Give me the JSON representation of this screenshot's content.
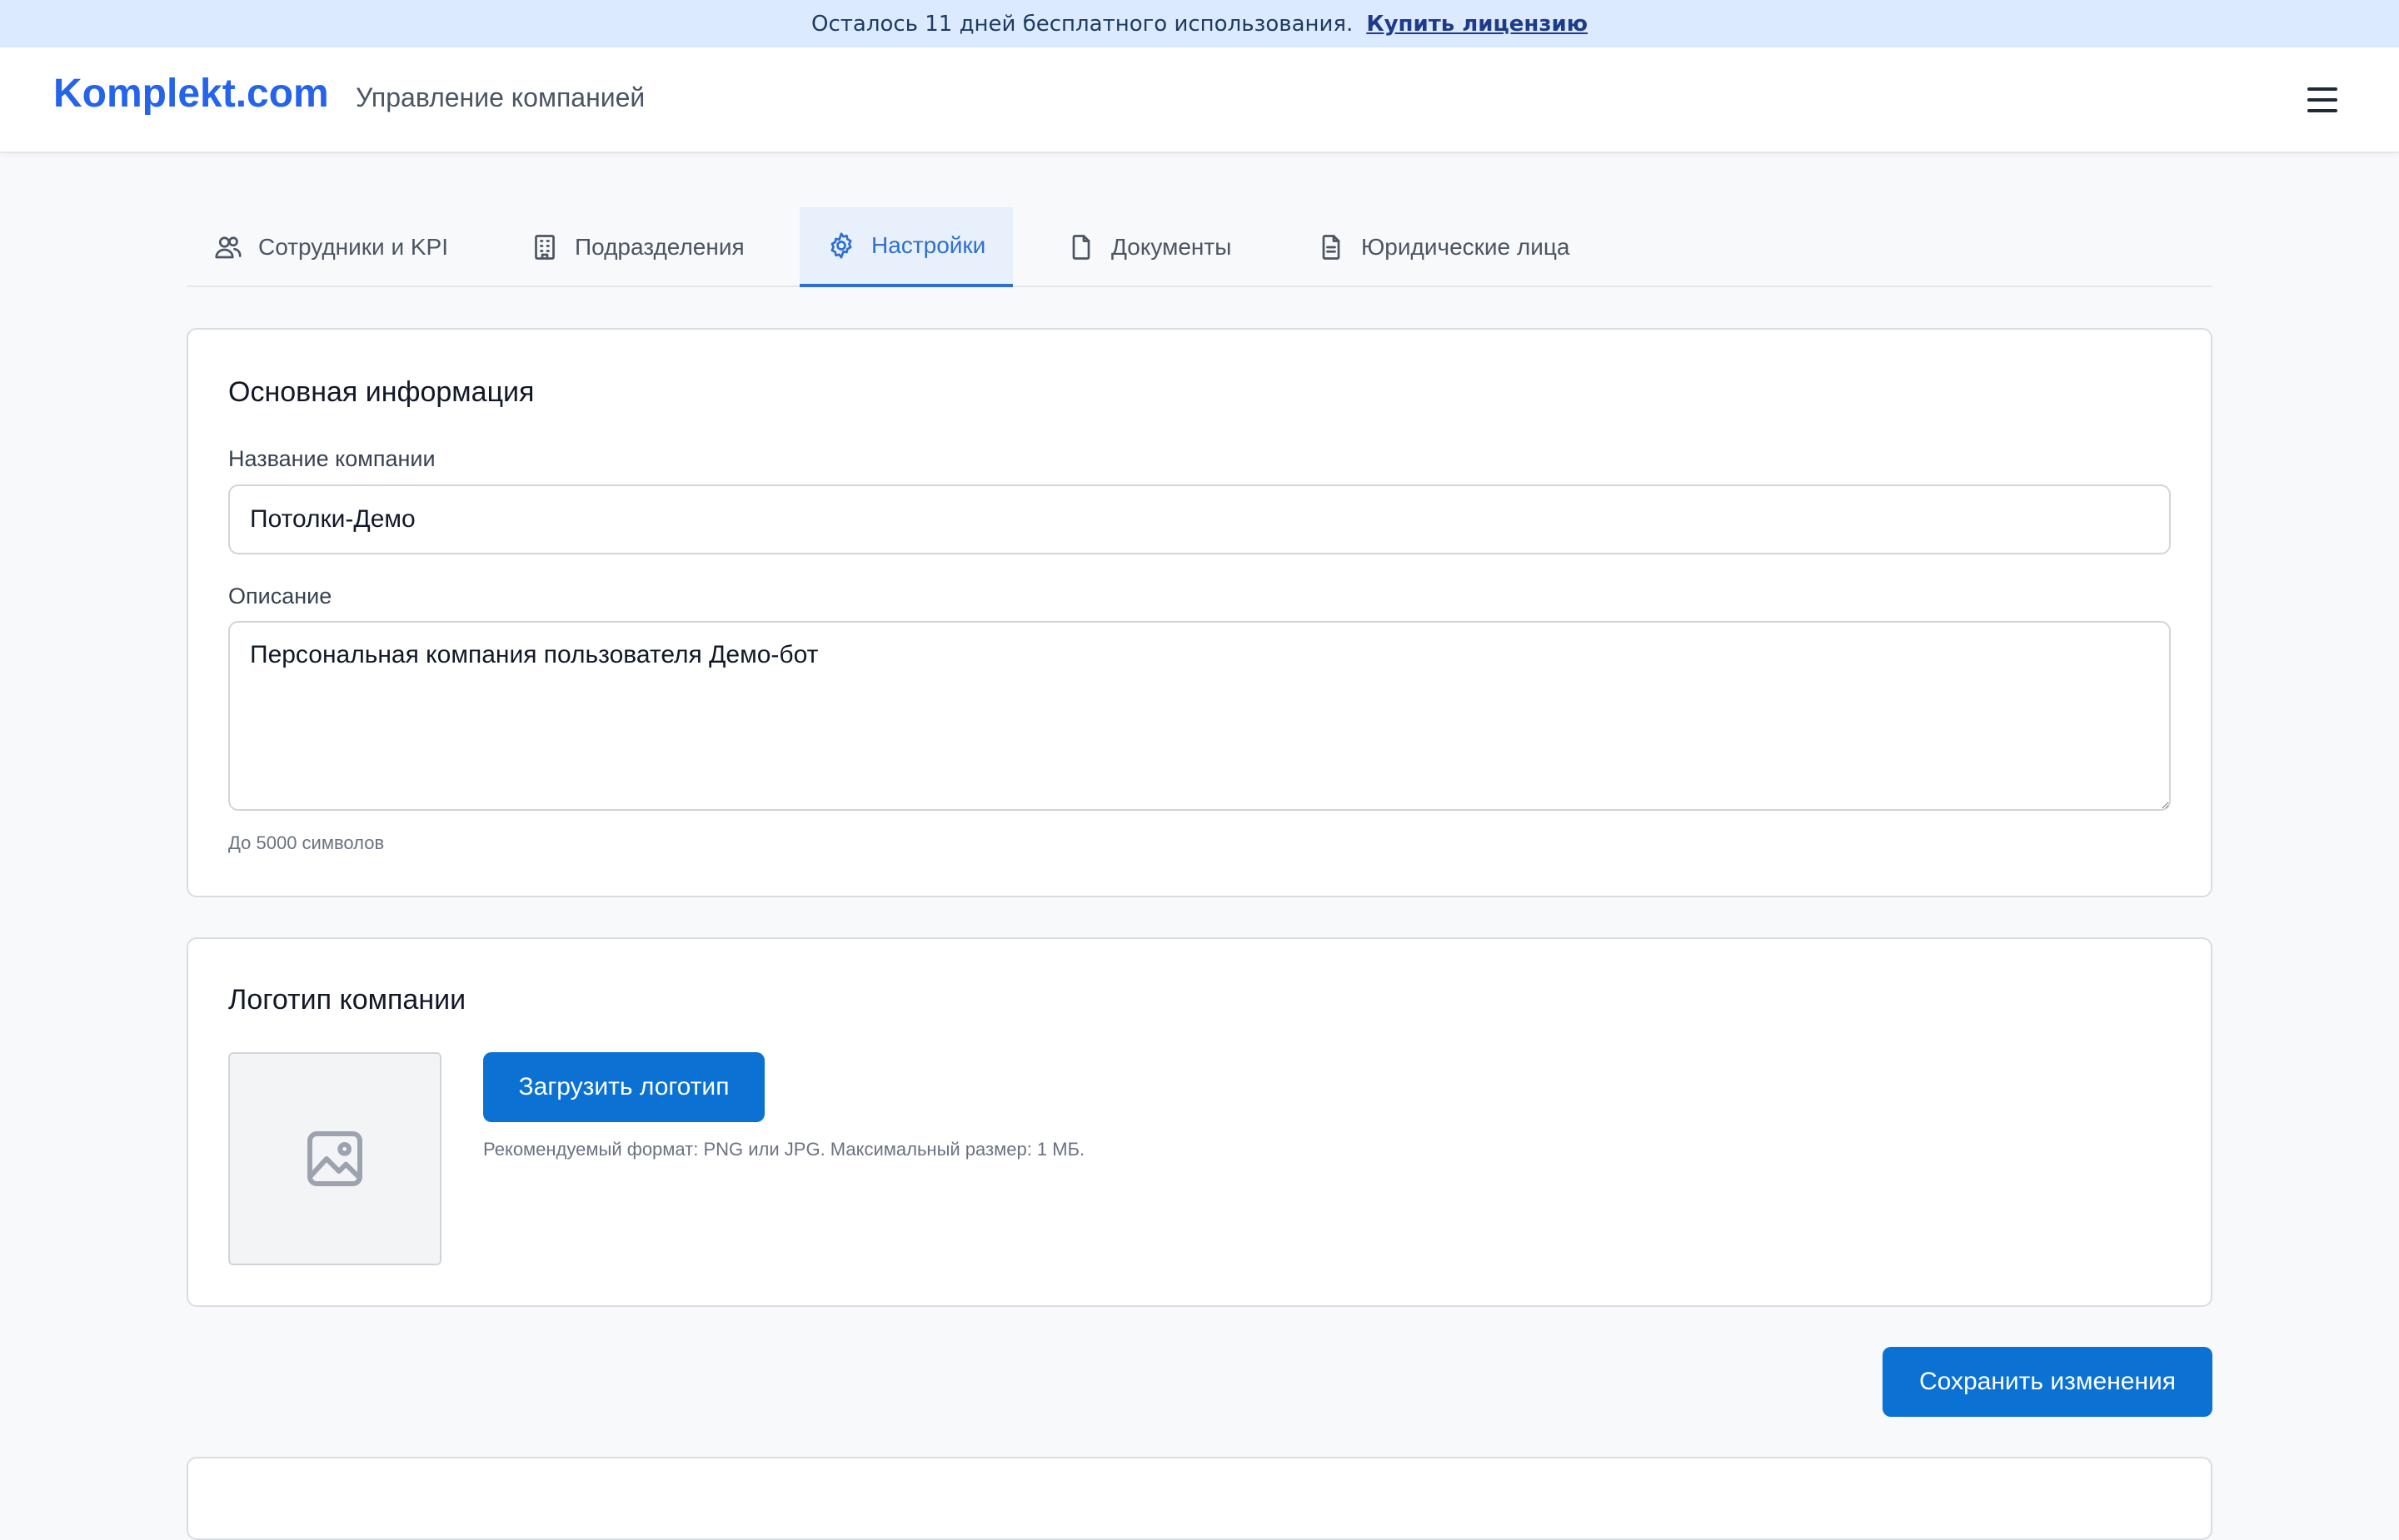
{
  "banner": {
    "message": "Осталось 11 дней бесплатного использования.",
    "buy_link": "Купить лицензию"
  },
  "header": {
    "logo": "Komplekt.com",
    "subtitle": "Управление компанией",
    "menu_icon": "hamburger-icon"
  },
  "tabs": [
    {
      "label": "Сотрудники и KPI",
      "icon": "users-icon",
      "active": false
    },
    {
      "label": "Подразделения",
      "icon": "building-icon",
      "active": false
    },
    {
      "label": "Настройки",
      "icon": "gear-icon",
      "active": true
    },
    {
      "label": "Документы",
      "icon": "file-icon",
      "active": false
    },
    {
      "label": "Юридические лица",
      "icon": "file-text-icon",
      "active": false
    }
  ],
  "basic_info": {
    "title": "Основная информация",
    "name_label": "Название компании",
    "name_value": "Потолки-Демо",
    "desc_label": "Описание",
    "desc_value": "Персональная компания пользователя Демо-бот",
    "desc_hint": "До 5000 символов"
  },
  "logo_section": {
    "title": "Логотип компании",
    "placeholder_icon": "image-icon",
    "upload_label": "Загрузить логотип",
    "hint": "Рекомендуемый формат: PNG или JPG. Максимальный размер: 1 МБ."
  },
  "actions": {
    "save_label": "Сохранить изменения"
  },
  "colors": {
    "brand": "#2563eb",
    "primary_button": "#0b72d3",
    "active_tab": "#2f6fcf",
    "banner_bg": "#dbeafe"
  }
}
